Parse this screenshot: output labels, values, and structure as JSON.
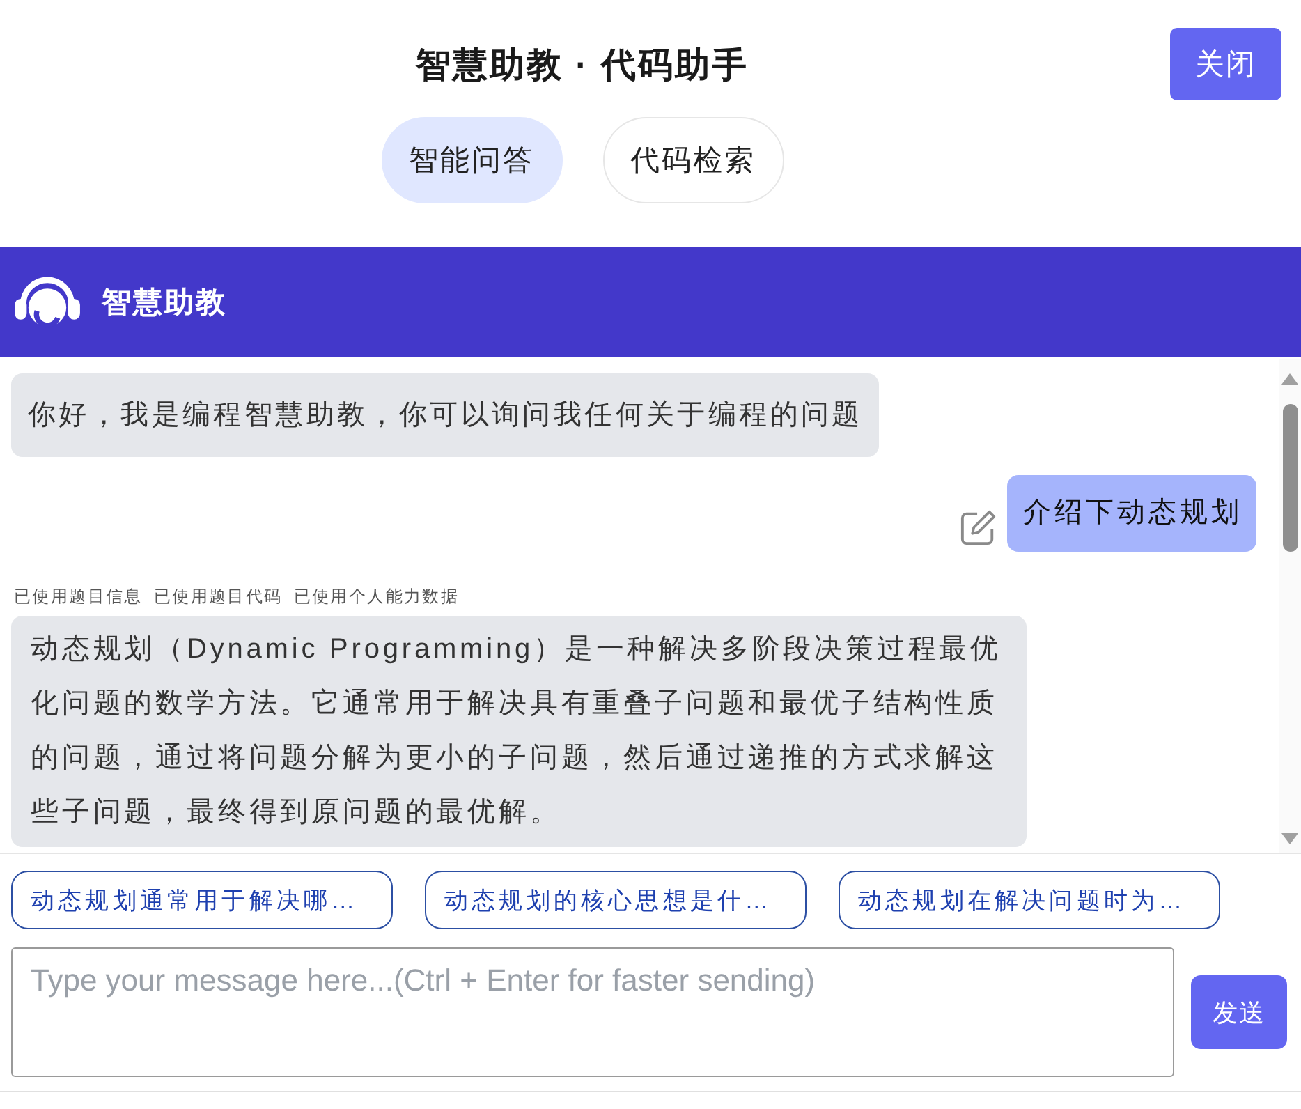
{
  "header": {
    "title": "智慧助教 · 代码助手",
    "close_button": "关闭"
  },
  "tabs": [
    {
      "label": "智能问答",
      "selected": true
    },
    {
      "label": "代码检索",
      "selected": false
    }
  ],
  "assistant_bar": {
    "title": "智慧助教"
  },
  "messages": [
    {
      "kind": "bot",
      "text": "你好，我是编程智慧助教，你可以询问我任何关于编程的问题"
    },
    {
      "kind": "user",
      "text": "介绍下动态规划",
      "editable": true
    },
    {
      "kind": "bot",
      "tags": [
        "已使用题目信息",
        "已使用题目代码",
        "已使用个人能力数据"
      ],
      "text": "动态规划（Dynamic Programming）是一种解决多阶段决策过程最优化问题的数学方法。它通常用于解决具有重叠子问题和最优子结构性质的问题，通过将问题分解为更小的子问题，然后通过递推的方式求解这些子问题，最终得到原问题的最优解。"
    }
  ],
  "suggestions": [
    "动态规划通常用于解决哪…",
    "动态规划的核心思想是什…",
    "动态规划在解决问题时为…"
  ],
  "composer": {
    "placeholder": "Type your message here...(Ctrl + Enter for faster sending)",
    "send_button": "发送"
  }
}
